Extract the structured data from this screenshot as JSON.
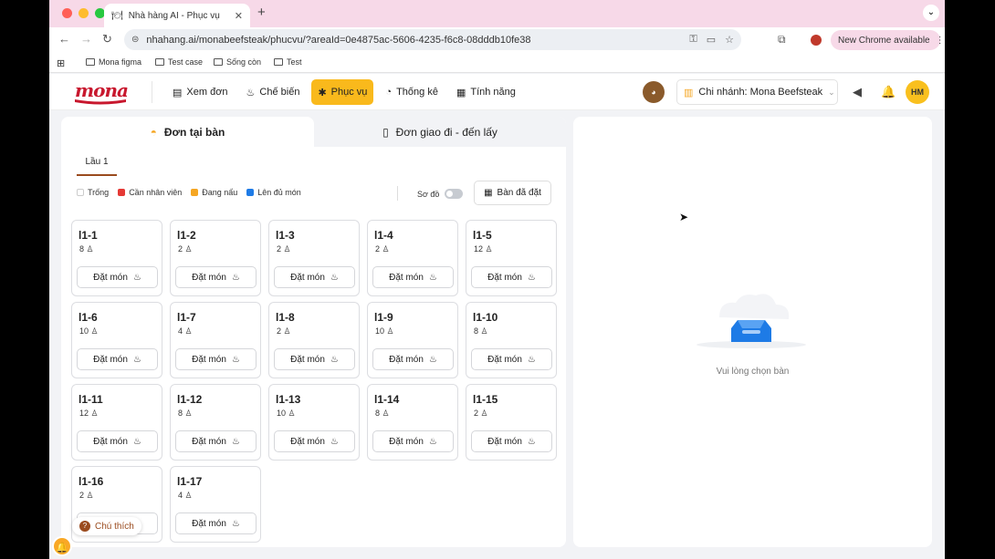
{
  "browser": {
    "tab_title": "Nhà hàng AI - Phục vụ",
    "tab_icon": "restaurant-icon",
    "url": "nhahang.ai/monabeefsteak/phucvu/?areaId=0e4875ac-5606-4235-f6c8-08dddb10fe38",
    "chrome_update": "New Chrome available",
    "bookmarks": [
      "Mona figma",
      "Test case",
      "Sống còn",
      "Test"
    ]
  },
  "app": {
    "logo": "mona",
    "menu": [
      {
        "label": "Xem đơn",
        "icon": "list-icon"
      },
      {
        "label": "Chế biến",
        "icon": "chef-icon"
      },
      {
        "label": "Phục vụ",
        "icon": "service-icon",
        "active": true
      },
      {
        "label": "Thống kê",
        "icon": "chart-icon"
      },
      {
        "label": "Tính năng",
        "icon": "grid-icon"
      }
    ],
    "branch": "Chi nhánh: Mona Beefsteak",
    "user_initials": "HM"
  },
  "panel": {
    "tab_dine_in": "Đơn tại bàn",
    "tab_delivery": "Đơn giao đi - đến lấy",
    "floor": "Lầu 1",
    "legend": [
      {
        "label": "Trống",
        "color": "#ffffff"
      },
      {
        "label": "Cần nhân viên",
        "color": "#e53935"
      },
      {
        "label": "Đang nấu",
        "color": "#f5a623"
      },
      {
        "label": "Lên đủ món",
        "color": "#1e7be6"
      }
    ],
    "map_toggle": "Sơ đồ",
    "booked_button": "Bàn đã đặt",
    "order_button": "Đặt món",
    "tables": [
      {
        "name": "l1-1",
        "seats": "8"
      },
      {
        "name": "l1-2",
        "seats": "2"
      },
      {
        "name": "l1-3",
        "seats": "2"
      },
      {
        "name": "l1-4",
        "seats": "2"
      },
      {
        "name": "l1-5",
        "seats": "12"
      },
      {
        "name": "l1-6",
        "seats": "10"
      },
      {
        "name": "l1-7",
        "seats": "4"
      },
      {
        "name": "l1-8",
        "seats": "2"
      },
      {
        "name": "l1-9",
        "seats": "10"
      },
      {
        "name": "l1-10",
        "seats": "8"
      },
      {
        "name": "l1-11",
        "seats": "12"
      },
      {
        "name": "l1-12",
        "seats": "8"
      },
      {
        "name": "l1-13",
        "seats": "10"
      },
      {
        "name": "l1-14",
        "seats": "8"
      },
      {
        "name": "l1-15",
        "seats": "2"
      },
      {
        "name": "l1-16",
        "seats": "2"
      },
      {
        "name": "l1-17",
        "seats": "4"
      }
    ],
    "note_button": "Chú thích"
  },
  "detail": {
    "empty_text": "Vui lòng chọn bàn"
  }
}
